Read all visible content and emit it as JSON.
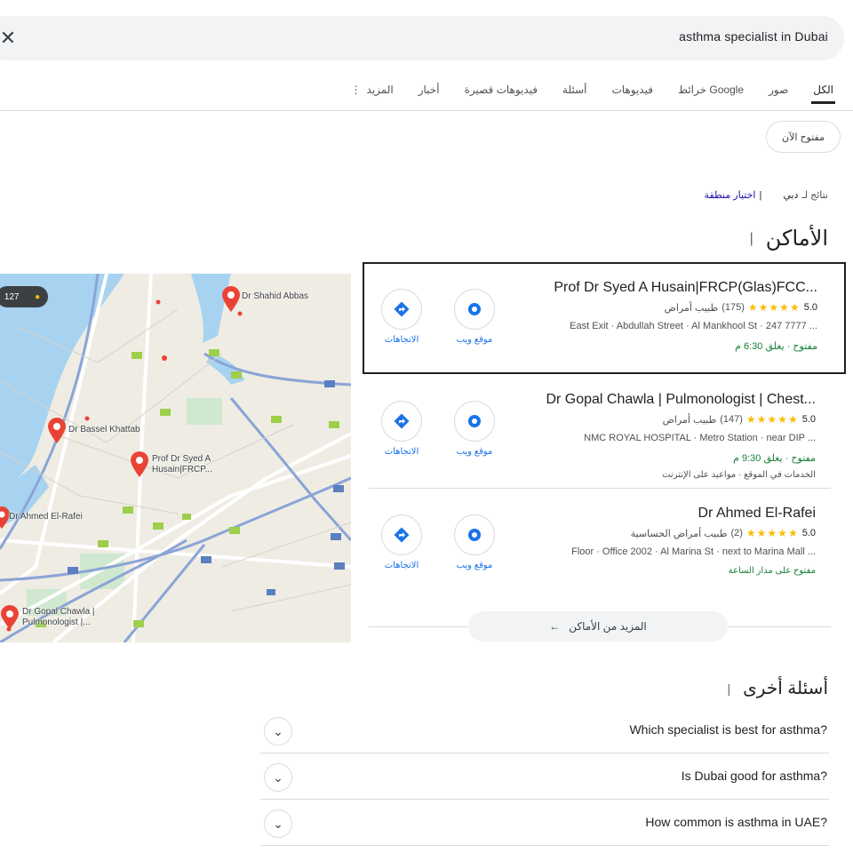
{
  "search": {
    "query": "asthma specialist in Dubai",
    "close_icon": "close-icon"
  },
  "tabs": [
    {
      "label": "الكل",
      "active": true
    },
    {
      "label": "صور"
    },
    {
      "label": "خرائط Google"
    },
    {
      "label": "فيديوهات"
    },
    {
      "label": "أسئلة"
    },
    {
      "label": "فيديوهات قصيرة"
    },
    {
      "label": "أخبار"
    },
    {
      "label": "المزيد"
    }
  ],
  "filter_chip": "مفتوح الآن",
  "results_line": {
    "prefix": "نتائج لـ",
    "location": "دبي",
    "link": "اختيار منطقة"
  },
  "places": {
    "title": "الأماكن",
    "items": [
      {
        "name": "Prof Dr Syed A Husain|FRCP(Glas)FCC...",
        "rating": "5.0",
        "stars": "★★★★★",
        "reviews": "(175)",
        "category": "طبيب أمراض",
        "address": "East Exit · Abdullah Street · Al Mankhool St · 247 7777 ...",
        "hours": "مفتوح · يغلق 6:30 م",
        "website_label": "موقع ويب",
        "directions_label": "الاتجاهات"
      },
      {
        "name": "Dr Gopal Chawla | Pulmonologist | Chest...",
        "rating": "5.0",
        "stars": "★★★★★",
        "reviews": "(147)",
        "category": "طبيب أمراض",
        "address": "NMC ROYAL HOSPITAL · Metro Station · near DIP ...",
        "hours": "مفتوح · يغلق 9:30 م",
        "extra": "الخدمات في الموقع · مواعيد على الإنترنت",
        "website_label": "موقع ويب",
        "directions_label": "الاتجاهات"
      },
      {
        "name": "Dr Ahmed El-Rafei",
        "rating": "5.0",
        "stars": "★★★★★",
        "reviews": "(2)",
        "category": "طبيب أمراض الحساسية",
        "address": "Floor · Office 2002 · Al Marina St · next to Marina Mall ...",
        "hours": "مفتوح على مدار الساعة",
        "website_label": "موقع ويب",
        "directions_label": "الاتجاهات"
      }
    ],
    "more_button": "المزيد من الأماكن"
  },
  "map": {
    "badge": "127",
    "pins": [
      {
        "label": "Dr Shahid Abbas"
      },
      {
        "label": "Dr Bassel Khattab"
      },
      {
        "label": "Prof Dr Syed A Husain|FRCP..."
      },
      {
        "label": "Dr Ahmed El-Rafei"
      },
      {
        "label": "Dr Gopal Chawla | Pulmonologist |..."
      }
    ]
  },
  "faq": {
    "title": "أسئلة أخرى",
    "items": [
      {
        "question": "Which specialist is best for asthma?"
      },
      {
        "question": "Is Dubai good for asthma?"
      },
      {
        "question": "How common is asthma in UAE?"
      }
    ]
  },
  "colors": {
    "link": "#1a0dab",
    "action_blue": "#1a73e8",
    "star": "#fbbc04",
    "pin": "#ea4335",
    "water": "#a8d3f0",
    "open_green": "#188038"
  }
}
